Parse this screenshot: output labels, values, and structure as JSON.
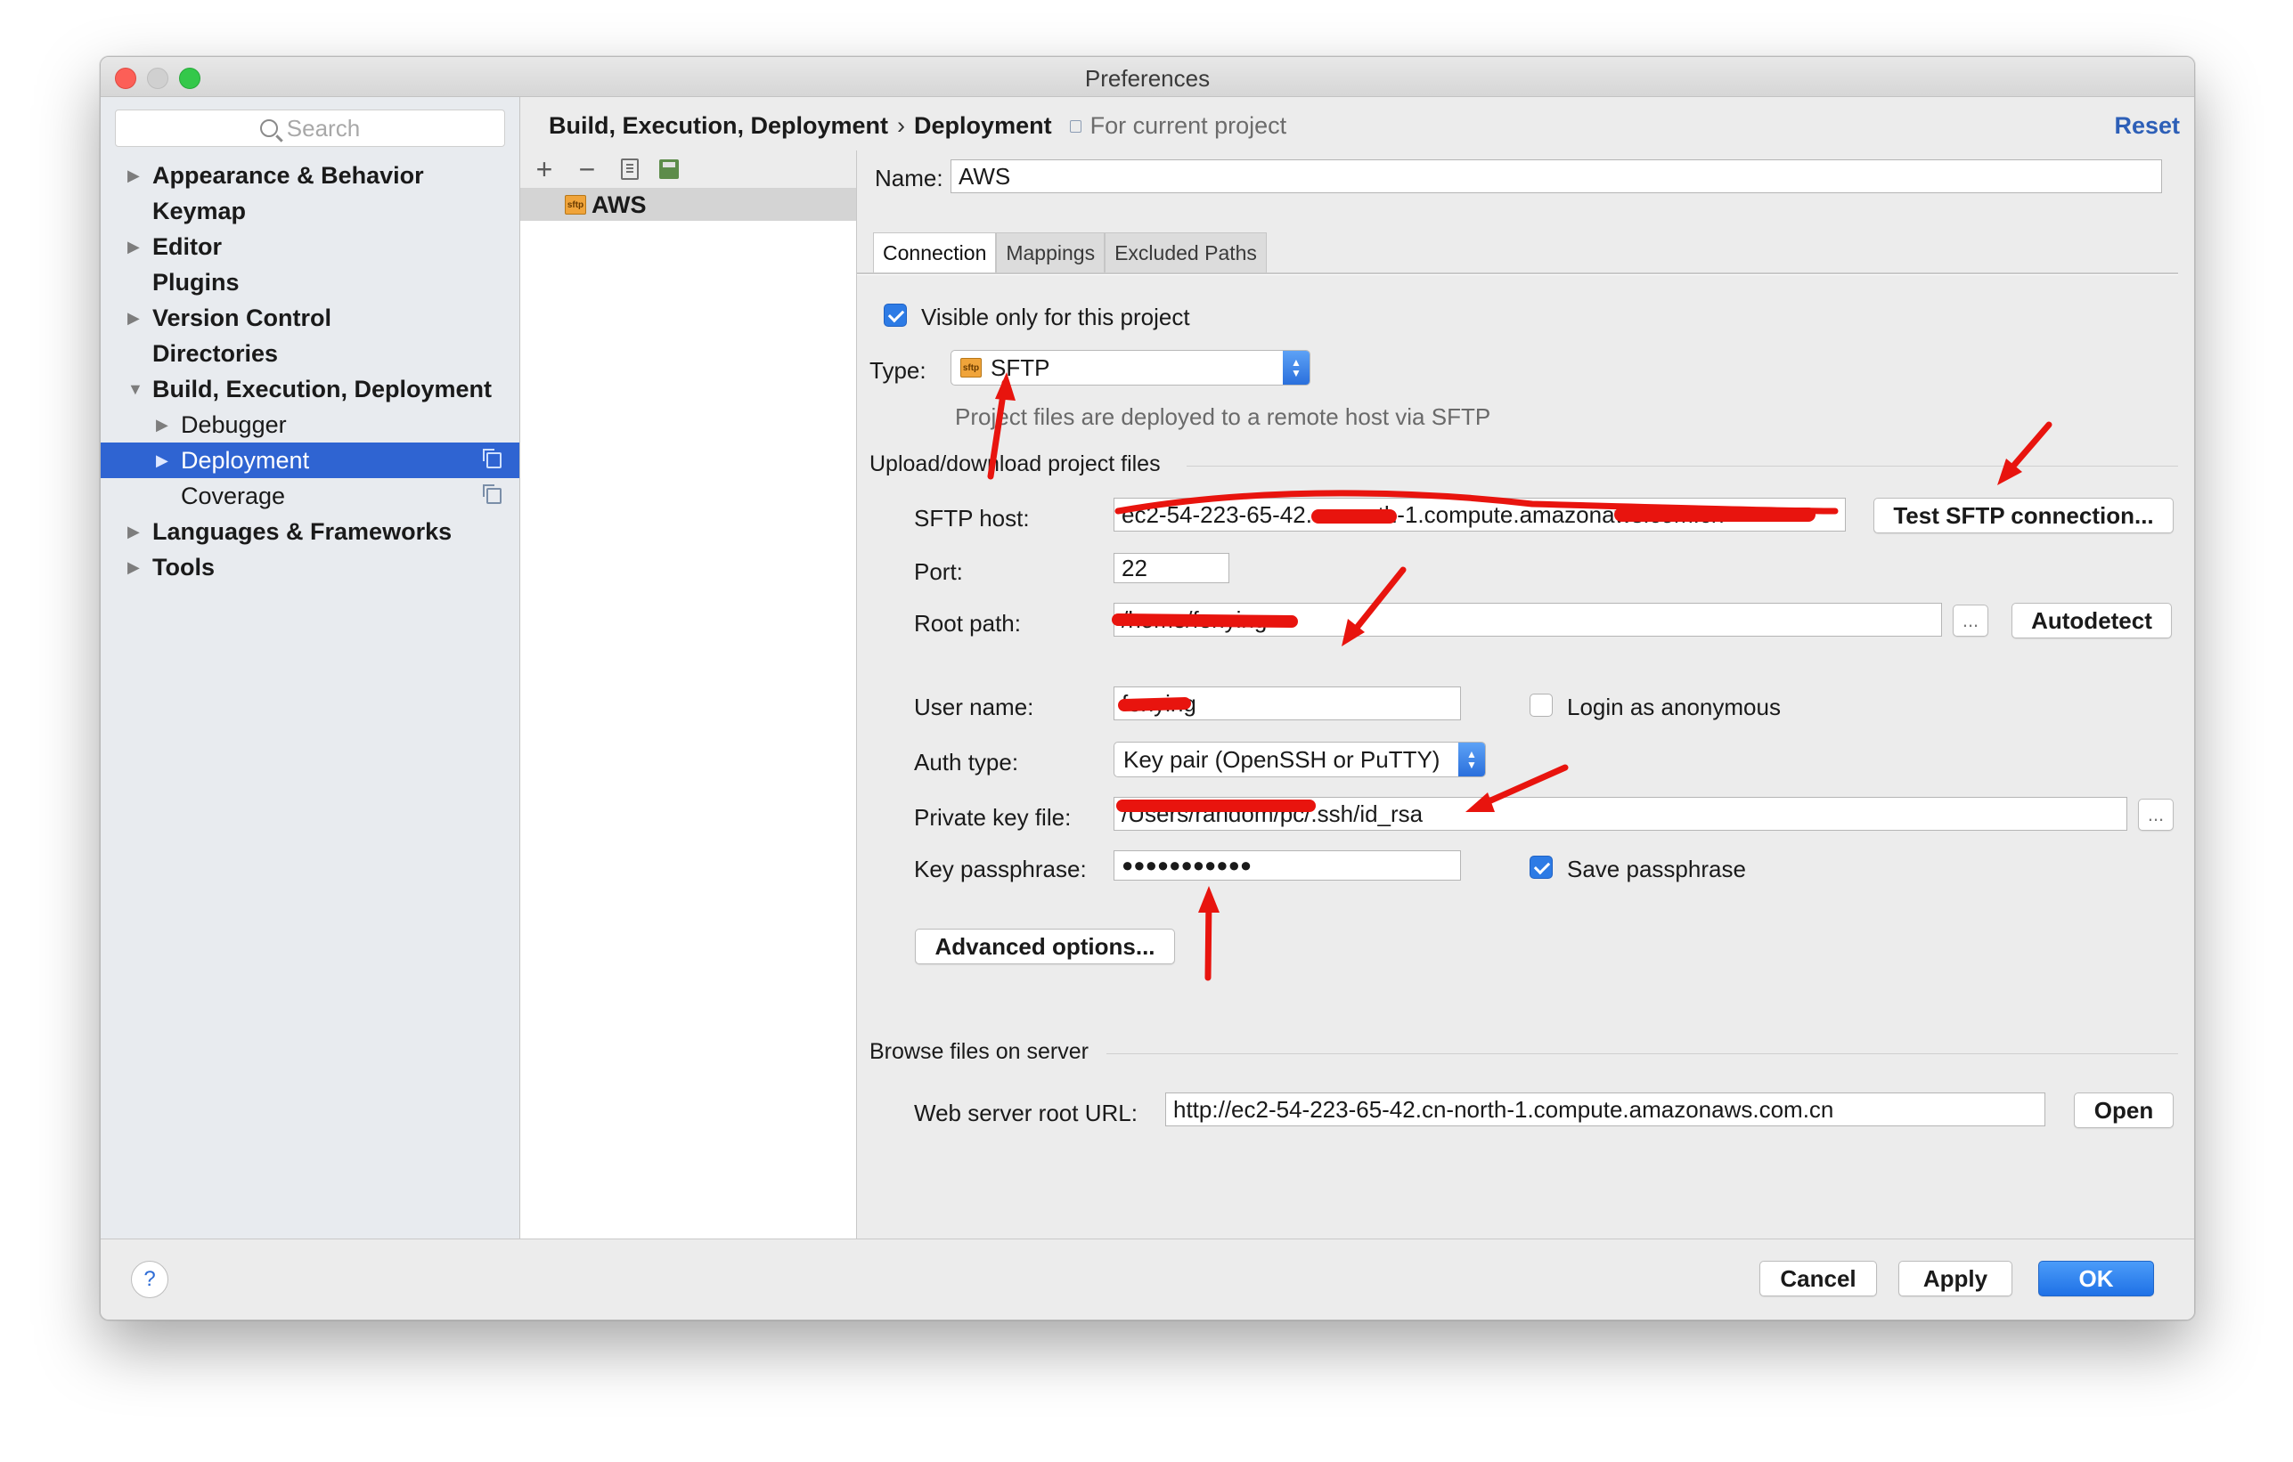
{
  "window": {
    "title": "Preferences"
  },
  "sidebar": {
    "search_placeholder": "Search",
    "items": [
      {
        "label": "Appearance & Behavior",
        "arrow": "▶"
      },
      {
        "label": "Keymap",
        "arrow": ""
      },
      {
        "label": "Editor",
        "arrow": "▶"
      },
      {
        "label": "Plugins",
        "arrow": ""
      },
      {
        "label": "Version Control",
        "arrow": "▶"
      },
      {
        "label": "Directories",
        "arrow": ""
      },
      {
        "label": "Build, Execution, Deployment",
        "arrow": "▼"
      },
      {
        "label": "Debugger",
        "arrow": "▶"
      },
      {
        "label": "Deployment",
        "arrow": "▶"
      },
      {
        "label": "Coverage",
        "arrow": ""
      },
      {
        "label": "Languages & Frameworks",
        "arrow": "▶"
      },
      {
        "label": "Tools",
        "arrow": "▶"
      }
    ]
  },
  "header": {
    "crumb_parent": "Build, Execution, Deployment",
    "separator": "›",
    "crumb_current": "Deployment",
    "scope": "For current project",
    "reset": "Reset"
  },
  "servers": {
    "toolbar": {
      "add": "+",
      "remove": "−"
    },
    "items": [
      {
        "label": "AWS",
        "icon": "sftp-icon",
        "icon_text": "sftp"
      }
    ]
  },
  "form": {
    "name_label": "Name:",
    "name_value": "AWS",
    "tabs": [
      "Connection",
      "Mappings",
      "Excluded Paths"
    ],
    "visible_only_label": "Visible only for this project",
    "visible_only_checked": true,
    "type_label": "Type:",
    "type_value": "SFTP",
    "type_hint": "Project files are deployed to a remote host via SFTP",
    "upload_section": "Upload/download project files",
    "sftp_host_label": "SFTP host:",
    "sftp_host_value": "ec2-54-223-65-42.cn-north-1.compute.amazonaws.com.cn",
    "test_button": "Test SFTP connection...",
    "port_label": "Port:",
    "port_value": "22",
    "root_path_label": "Root path:",
    "root_path_value": "/home/fenying",
    "browse_label": "...",
    "autodetect_button": "Autodetect",
    "user_name_label": "User name:",
    "user_name_value": "fenying",
    "login_anonymous_label": "Login as anonymous",
    "login_anonymous_checked": false,
    "auth_type_label": "Auth type:",
    "auth_type_value": "Key pair (OpenSSH or PuTTY)",
    "private_key_label": "Private key file:",
    "private_key_value": "/Users/random/pc/.ssh/id_rsa",
    "key_passphrase_label": "Key passphrase:",
    "key_passphrase_value": "●●●●●●●●●●●",
    "save_passphrase_label": "Save passphrase",
    "save_passphrase_checked": true,
    "advanced_button": "Advanced options...",
    "browse_section": "Browse files on server",
    "web_root_label": "Web server root URL:",
    "web_root_value": "http://ec2-54-223-65-42.cn-north-1.compute.amazonaws.com.cn",
    "open_button": "Open"
  },
  "footer": {
    "help": "?",
    "cancel": "Cancel",
    "apply": "Apply",
    "ok": "OK"
  },
  "colors": {
    "selection": "#2f64d2",
    "accent": "#2d7be5",
    "annotation": "#e8140e"
  }
}
